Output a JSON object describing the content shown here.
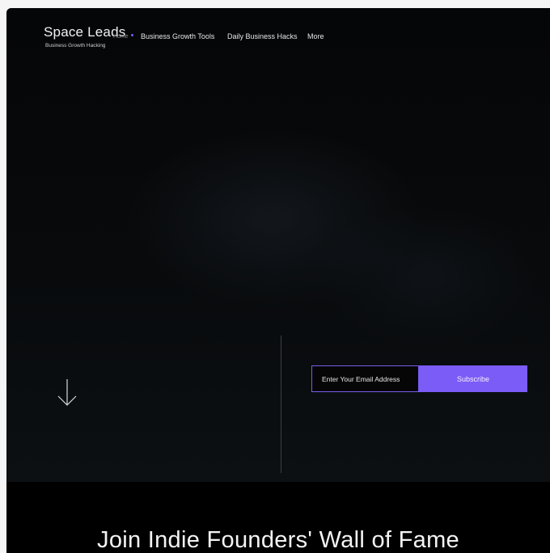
{
  "header": {
    "logo_text": "Space Leads",
    "tagline": "Business Growth Hacking",
    "nav": {
      "home": "Home",
      "tools": "Business Growth Tools",
      "hacks": "Daily Business Hacks",
      "more": "More"
    }
  },
  "hero": {
    "scroll_icon": "arrow-down-icon",
    "email_placeholder": "Enter Your Email Address",
    "subscribe_label": "Subscribe"
  },
  "section": {
    "title": "Join Indie Founders' Wall of Fame"
  },
  "colors": {
    "accent": "#7b5cf6",
    "background": "#050607"
  }
}
